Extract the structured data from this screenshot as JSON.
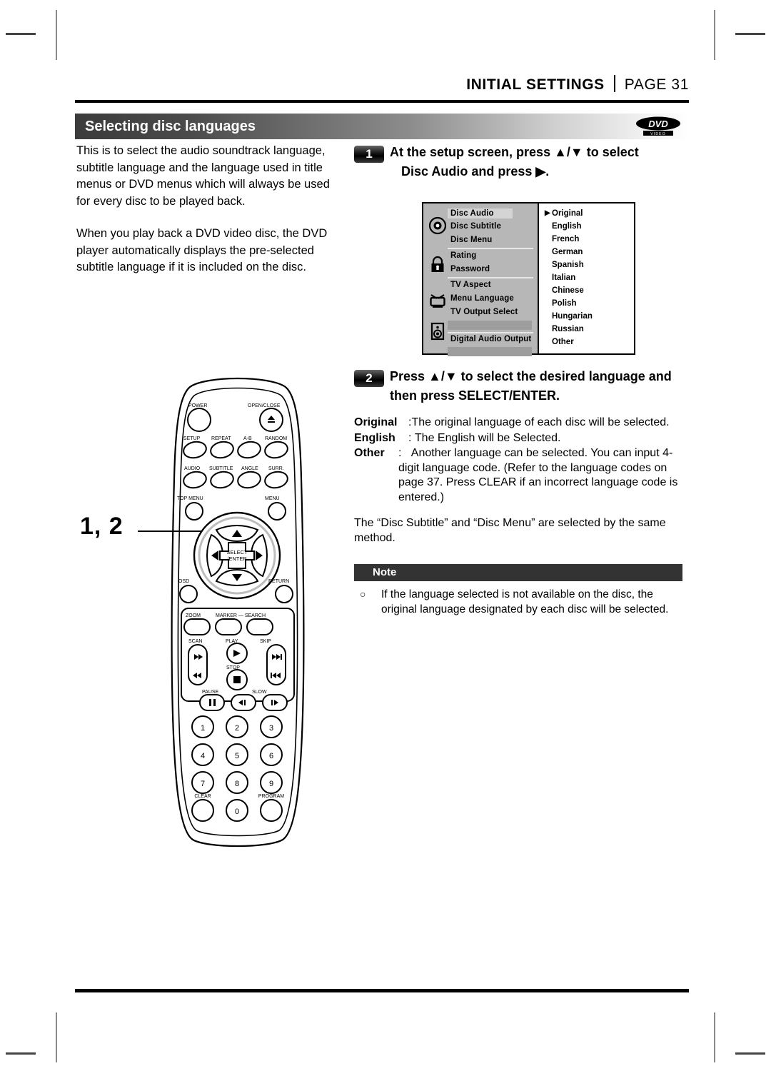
{
  "header": {
    "title": "INITIAL SETTINGS",
    "page_label": "PAGE 31"
  },
  "section": {
    "title": "Selecting disc languages",
    "logo": "dvd-video-logo"
  },
  "intro": {
    "paragraph1": "This is to select the audio soundtrack language, subtitle language and the language used in title menus or DVD menus which will always be used for every disc to be played back.",
    "paragraph2": "When you play back a DVD video disc, the DVD player automatically displays the pre-selected subtitle language if it is included on the disc."
  },
  "steps": [
    {
      "number": "1",
      "line1": "At the setup screen, press ▲/▼ to select",
      "line2": "Disc Audio  and press ▶."
    },
    {
      "number": "2",
      "line1": "Press ▲/▼ to select the desired language and",
      "line2": "then press SELECT/ENTER."
    }
  ],
  "setup_screen": {
    "menu_items": [
      {
        "label": "Disc Audio",
        "selected": true
      },
      {
        "label": "Disc Subtitle",
        "selected": false
      },
      {
        "label": "Disc Menu",
        "selected": false
      },
      {
        "label": "Rating",
        "selected": false
      },
      {
        "label": "Password",
        "selected": false
      },
      {
        "label": "TV Aspect",
        "selected": false
      },
      {
        "label": "Menu Language",
        "selected": false
      },
      {
        "label": "TV Output Select",
        "selected": false
      },
      {
        "label": "Digital Audio Output",
        "selected": false
      }
    ],
    "icons": [
      "disc-icon",
      "lock-icon",
      "tv-icon",
      "speaker-icon"
    ],
    "language_options": [
      {
        "label": "Original",
        "marker": "▶"
      },
      {
        "label": "English",
        "marker": ""
      },
      {
        "label": "French",
        "marker": ""
      },
      {
        "label": "German",
        "marker": ""
      },
      {
        "label": "Spanish",
        "marker": ""
      },
      {
        "label": "Italian",
        "marker": ""
      },
      {
        "label": "Chinese",
        "marker": ""
      },
      {
        "label": "Polish",
        "marker": ""
      },
      {
        "label": "Hungarian",
        "marker": ""
      },
      {
        "label": "Russian",
        "marker": ""
      },
      {
        "label": "Other",
        "marker": ""
      }
    ]
  },
  "definitions": [
    {
      "term": "Original",
      "sep": ":",
      "text": "The original language of each disc will be selected."
    },
    {
      "term": "English",
      "sep": ":",
      "text": "The English will be Selected."
    },
    {
      "term": "Other",
      "sep": ":",
      "text": "Another language can be selected. You can input 4-digit language code. (Refer to the language codes on page 37. Press CLEAR if an incorrect language code is entered.)"
    }
  ],
  "subnote": "The “Disc Subtitle” and “Disc Menu” are selected by the same method.",
  "note": {
    "heading": "Note",
    "bullet": "○",
    "text": "If the language selected is not available on the disc, the original language designated by each disc will be selected."
  },
  "remote": {
    "callout": "1, 2",
    "buttons": {
      "power": "POWER",
      "open_close": "OPEN/CLOSE",
      "setup": "SETUP",
      "repeat": "REPEAT",
      "ab": "A-B",
      "random": "RANDOM",
      "audio": "AUDIO",
      "subtitle": "SUBTITLE",
      "angle": "ANGLE",
      "surr": "SURR.",
      "top_menu": "TOP MENU",
      "menu": "MENU",
      "select_enter_line1": "SELECT",
      "select_enter_line2": "/ENTER",
      "osd": "OSD",
      "return": "RETURN",
      "zoom": "ZOOM",
      "marker_search": "MARKER — SEARCH",
      "scan": "SCAN",
      "play": "PLAY",
      "skip": "SKIP",
      "stop": "STOP",
      "pause": "PAUSE",
      "slow": "SLOW",
      "clear": "CLEAR",
      "program": "PROGRAM"
    },
    "keypad": [
      "1",
      "2",
      "3",
      "4",
      "5",
      "6",
      "7",
      "8",
      "9",
      "0"
    ]
  }
}
